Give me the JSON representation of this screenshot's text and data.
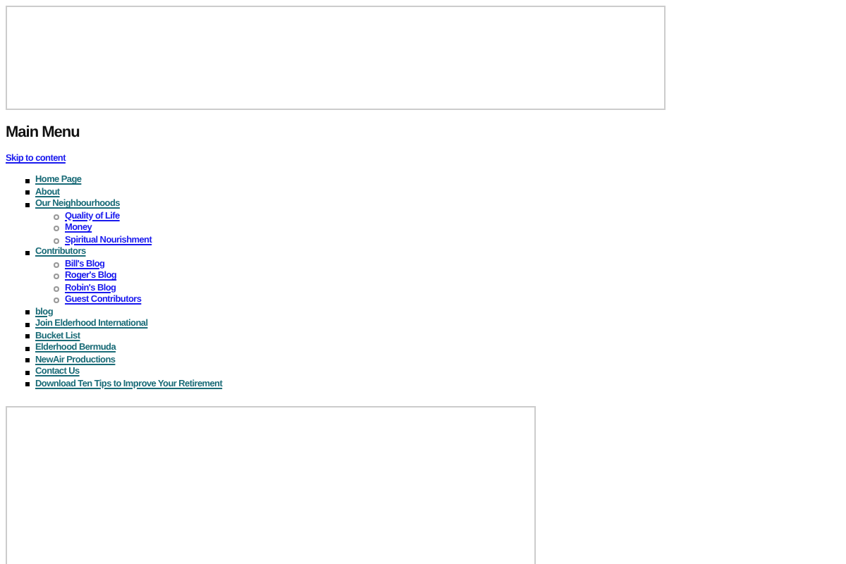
{
  "heading": "Main Menu",
  "skip_link": "Skip to content",
  "menu": [
    {
      "label": "Home Page"
    },
    {
      "label": "About"
    },
    {
      "label": "Our Neighbourhoods",
      "children": [
        {
          "label": "Quality of Life"
        },
        {
          "label": "Money"
        },
        {
          "label": "Spiritual Nourishment"
        }
      ]
    },
    {
      "label": "Contributors",
      "children": [
        {
          "label": "Bill's Blog"
        },
        {
          "label": "Roger's Blog"
        },
        {
          "label": "Robin's Blog"
        },
        {
          "label": "Guest Contributors"
        }
      ]
    },
    {
      "label": "blog"
    },
    {
      "label": "Join Elderhood International"
    },
    {
      "label": "Bucket List"
    },
    {
      "label": "Elderhood Bermuda"
    },
    {
      "label": "NewAir Productions"
    },
    {
      "label": "Contact Us"
    },
    {
      "label": "Download Ten Tips to Improve Your Retirement"
    }
  ]
}
